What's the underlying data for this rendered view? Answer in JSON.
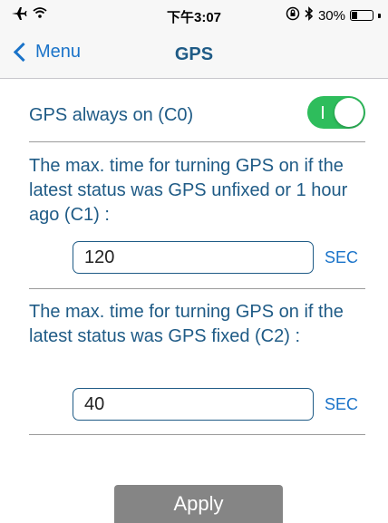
{
  "status_bar": {
    "time": "下午3:07",
    "battery_text": "30%",
    "battery_level": 0.3,
    "icons": [
      "airplane-icon",
      "wifi-icon",
      "rotation-lock-icon",
      "bluetooth-icon",
      "battery-icon"
    ]
  },
  "nav": {
    "back_label": "Menu",
    "title": "GPS"
  },
  "settings": {
    "gps_always_on": {
      "label": "GPS always on (C0)",
      "enabled": true
    },
    "c1": {
      "description": "The max. time for turning GPS on if the latest status was GPS unfixed or 1 hour ago (C1) :",
      "value": "120",
      "unit": "SEC"
    },
    "c2": {
      "description": "The max. time for turning GPS on if the latest status was GPS fixed (C2) :",
      "value": "40",
      "unit": "SEC"
    }
  },
  "apply_label": "Apply",
  "colors": {
    "accent": "#1a73c9",
    "text": "#1f5b86",
    "toggle_on": "#2ebd5c",
    "apply_bg": "#858585"
  }
}
